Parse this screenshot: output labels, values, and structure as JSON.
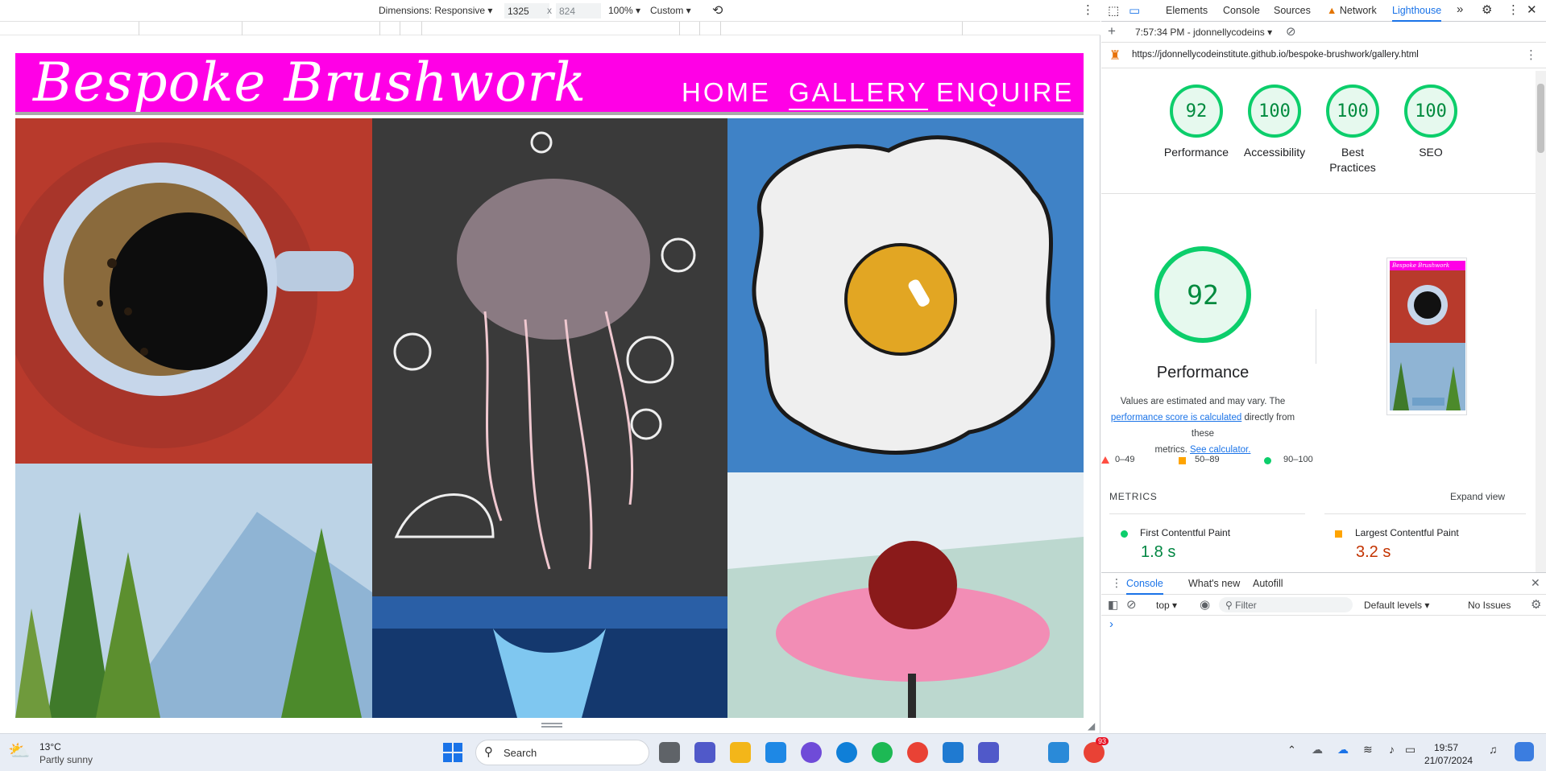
{
  "device_toolbar": {
    "dimensions_label": "Dimensions: Responsive",
    "width": "1325",
    "height": "824",
    "times": "x",
    "zoom": "100%",
    "throttle": "Custom"
  },
  "site": {
    "brand": "Bespoke Brushwork",
    "nav": [
      "HOME",
      "GALLERY",
      "ENQUIRE"
    ],
    "active_nav": "GALLERY",
    "colors": {
      "header": "#ff00e6",
      "header_border": "#a9a9a9"
    }
  },
  "devtools": {
    "tabs": [
      "Elements",
      "Console",
      "Sources",
      "Network",
      "Lighthouse"
    ],
    "active_tab": "Lighthouse",
    "report_selector": "7:57:34 PM - jdonnellycodeins",
    "url": "https://jdonnellycodeinstitute.github.io/bespoke-brushwork/gallery.html",
    "scores": [
      {
        "value": "92",
        "label": "Performance"
      },
      {
        "value": "100",
        "label": "Accessibility"
      },
      {
        "value": "100",
        "label": "Best Practices"
      },
      {
        "value": "100",
        "label": "SEO"
      }
    ],
    "performance": {
      "score": "92",
      "title": "Performance",
      "desc_1": "Values are estimated and may vary. The",
      "desc_link_1": "performance score is calculated",
      "desc_2": "directly from these",
      "desc_3": "metrics.",
      "desc_link_2": "See calculator.",
      "thumb_brand": "Bespoke Brushwork"
    },
    "legend": [
      {
        "range": "0–49",
        "color": "#ff4e42"
      },
      {
        "range": "50–89",
        "color": "#ffa400"
      },
      {
        "range": "90–100",
        "color": "#0cce6b"
      }
    ],
    "metrics": {
      "heading": "METRICS",
      "expand": "Expand view",
      "items": [
        {
          "label": "First Contentful Paint",
          "value": "1.8 s",
          "color": "#0cce6b",
          "value_color": "#018642"
        },
        {
          "label": "Largest Contentful Paint",
          "value": "3.2 s",
          "color": "#ffa400",
          "value_color": "#c33300"
        }
      ]
    },
    "drawer": {
      "tabs": [
        "Console",
        "What's new",
        "Autofill"
      ],
      "active_tab": "Console",
      "context": "top",
      "filter_placeholder": "Filter",
      "levels": "Default levels",
      "issues": "No Issues",
      "prompt": "›"
    }
  },
  "taskbar": {
    "weather_temp": "13°C",
    "weather_desc": "Partly sunny",
    "search_placeholder": "Search",
    "time": "19:57",
    "date": "21/07/2024",
    "badge_count": "93"
  }
}
